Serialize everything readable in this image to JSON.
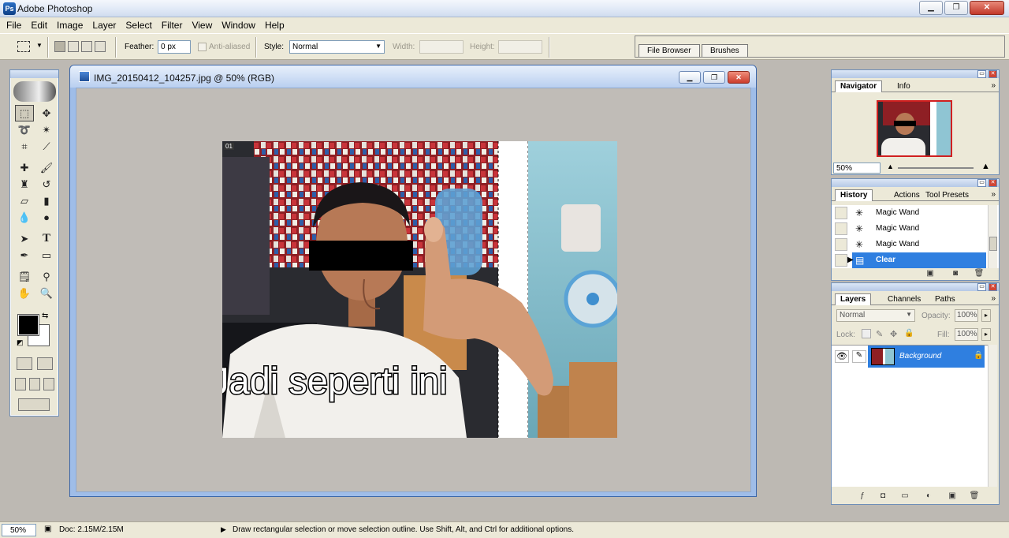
{
  "app": {
    "title": "Adobe Photoshop",
    "icon": "Ps"
  },
  "window_controls": {
    "minimize": "▁",
    "restore": "❐",
    "close": "✕"
  },
  "menu": [
    "File",
    "Edit",
    "Image",
    "Layer",
    "Select",
    "Filter",
    "View",
    "Window",
    "Help"
  ],
  "options": {
    "feather_label": "Feather:",
    "feather_value": "0 px",
    "antialiased_label": "Anti-aliased",
    "style_label": "Style:",
    "style_value": "Normal",
    "width_label": "Width:",
    "height_label": "Height:",
    "well_tabs": [
      "File Browser",
      "Brushes"
    ]
  },
  "document": {
    "title": "IMG_20150412_104257.jpg @ 50% (RGB)",
    "slice_tag": "01",
    "overlay_text": "Jadi seperti ini"
  },
  "navigator": {
    "tabs": [
      "Navigator",
      "Info"
    ],
    "zoom": "50%"
  },
  "history": {
    "tabs": [
      "History",
      "Actions",
      "Tool Presets"
    ],
    "items": [
      {
        "label": "Magic Wand",
        "selected": false
      },
      {
        "label": "Magic Wand",
        "selected": false
      },
      {
        "label": "Magic Wand",
        "selected": false
      },
      {
        "label": "Clear",
        "selected": true
      }
    ]
  },
  "layers": {
    "tabs": [
      "Layers",
      "Channels",
      "Paths"
    ],
    "blend_mode": "Normal",
    "opacity_label": "Opacity:",
    "opacity_value": "100%",
    "lock_label": "Lock:",
    "fill_label": "Fill:",
    "fill_value": "100%",
    "items": [
      {
        "name": "Background"
      }
    ]
  },
  "status": {
    "zoom": "50%",
    "doc": "Doc: 2.15M/2.15M",
    "message": "Draw rectangular selection or move selection outline.  Use Shift, Alt, and Ctrl for additional options."
  },
  "colors": {
    "selection_blue": "#2f7fe0",
    "foreground": "#000000",
    "background": "#ffffff"
  }
}
